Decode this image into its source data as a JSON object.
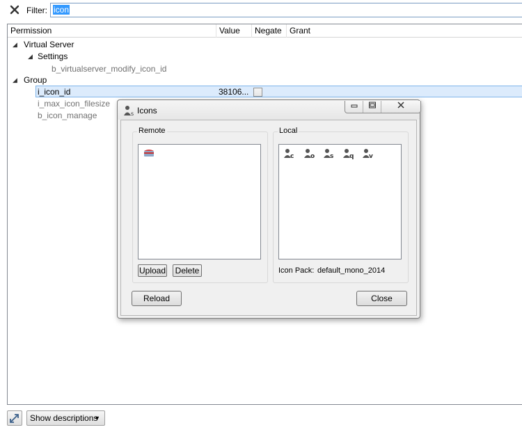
{
  "filter": {
    "label": "Filter:",
    "value": "icon"
  },
  "tree": {
    "columns": [
      "Permission",
      "Value",
      "Negate",
      "Grant"
    ],
    "rows": {
      "virtual_server": "Virtual Server",
      "settings": "Settings",
      "modify_icon_id": "b_virtualserver_modify_icon_id",
      "group": "Group",
      "i_icon_id": "i_icon_id",
      "i_icon_id_value": "38106...",
      "i_max_icon_filesize": "i_max_icon_filesize",
      "b_icon_manage": "b_icon_manage"
    }
  },
  "bottom": {
    "show_descriptions": "Show descriptions"
  },
  "dialog": {
    "title": "Icons",
    "remote": {
      "title": "Remote",
      "upload": "Upload",
      "delete": "Delete"
    },
    "local": {
      "title": "Local",
      "icons": [
        "c",
        "o",
        "s",
        "q",
        "v"
      ],
      "icon_pack_label": "Icon Pack:",
      "icon_pack_value": "default_mono_2014"
    },
    "reload": "Reload",
    "close": "Close"
  }
}
